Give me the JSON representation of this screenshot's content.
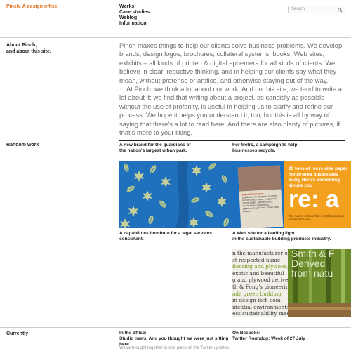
{
  "header": {
    "brand": "Pinch. A design office.",
    "nav": [
      "Works",
      "Case studies",
      "Weblog",
      "Information"
    ],
    "search_placeholder": "Search"
  },
  "about": {
    "label_line1": "About Pinch,",
    "label_line2": "and about this site.",
    "paragraph1": "Pinch makes things to help our clients solve business problems. We develop brands, design logos, brochures, collateral systems, books, Web sites, exhibits – all kinds of printed & digital ephemera for all kinds of clients. We believe in clear, reductive thinking, and in helping our clients say what they mean, without pretense or artifice, and otherwise staying out of the way.",
    "paragraph2": "At Pinch, we think a lot about our work. And on this site, we tend to write a lot about it: we find that writing about a project, as candidly as possible without the use of profanity, is useful in helping us to clarify and refine our process. We hope it helps you understand it, too; but this is all by way of saying that there’s a lot to read here. And there are also plenty of pictures, if that’s more to your liking."
  },
  "random_work": {
    "label": "Random work",
    "items": [
      {
        "caption_line1": "A new brand for the guardians of",
        "caption_line2": "the nation's largest urban park."
      },
      {
        "caption_line1": "For Metro, a campaign to help",
        "caption_line2": "businesses recycle."
      },
      {
        "caption_line1": "A capabilities brochure for a legal services consultant.",
        "caption_line2": ""
      },
      {
        "caption_line1": "A Web site for a leading light",
        "caption_line2": "in the sustainable building products industry."
      }
    ],
    "metro_ad": {
      "headline": "20 tons of recyclable paper metro-area businesses every Here's something simple you",
      "big_text": "re: a",
      "sub_text": "The means of more than 9,000 businesses in the metro area",
      "paper_title": "Paper & Packaging",
      "paper_body": "Cardboard and paper of all colors recycle: office paper, magazines, phone books, manila folders, newspapers, paper bags, paperboard, junk mail. Paper bags no wax."
    },
    "smith_site": {
      "lines": [
        "n the manufacturer of",
        "st respected name",
        "flooring and plywood, and",
        "exotic and beautiful",
        "g and plywood derived",
        "th & Fong's pioneering,",
        "ade green building",
        "in design-rich com",
        "idential environments",
        "ess sustainability meets"
      ],
      "title_line1": "Smith & F",
      "title_line2": "Derived",
      "title_line3": "from natu"
    }
  },
  "currently": {
    "label": "Currently",
    "office_label": "In the office:",
    "office_text": "Studio news. And you thought we were just sitting here.",
    "bespoke_label": "On Bespoke:",
    "bespoke_text": "Twitter Roundup: Week of 27 July",
    "footer_fragment": "We've brought together in one place all the Twitter updates"
  },
  "colors": {
    "brand": "#e0701c",
    "park_blue": "#1f70bd",
    "metro_orange": "#f3a01e",
    "metro_yellow": "#ffd23b",
    "leaf_green": "#5a7a1a"
  }
}
